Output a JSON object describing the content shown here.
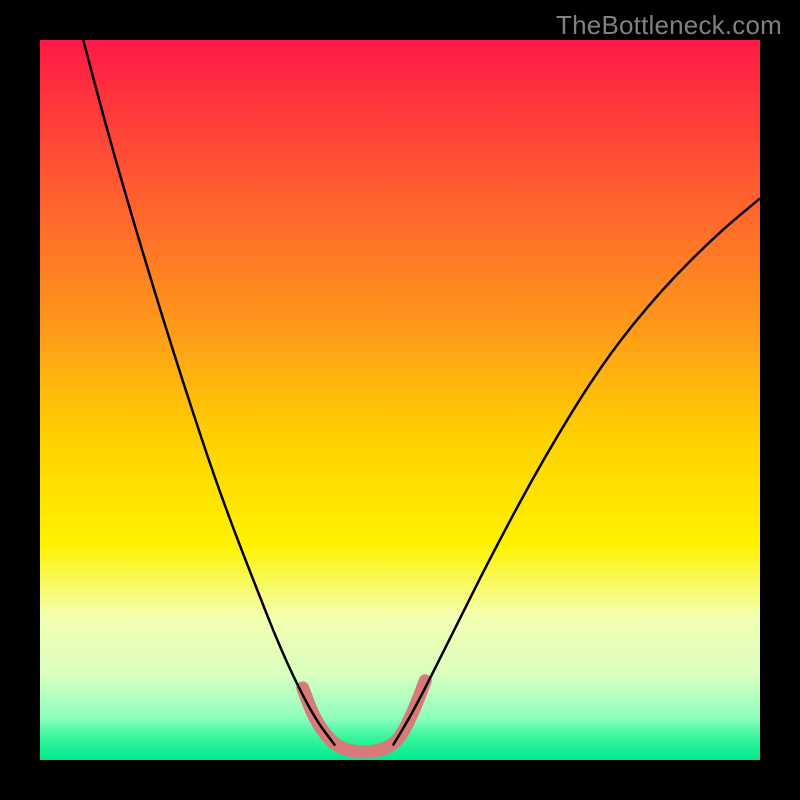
{
  "watermark": "TheBottleneck.com",
  "chart_data": {
    "type": "line",
    "title": "",
    "xlabel": "",
    "ylabel": "",
    "xlim": [
      0,
      100
    ],
    "ylim": [
      0,
      100
    ],
    "gradient_stops": [
      {
        "offset": 0,
        "color": "#ff1a47"
      },
      {
        "offset": 0.1,
        "color": "#ff3a3a"
      },
      {
        "offset": 0.25,
        "color": "#ff6a2a"
      },
      {
        "offset": 0.4,
        "color": "#ff9a1a"
      },
      {
        "offset": 0.55,
        "color": "#ffd000"
      },
      {
        "offset": 0.7,
        "color": "#fff200"
      },
      {
        "offset": 0.8,
        "color": "#f4ffb0"
      },
      {
        "offset": 0.88,
        "color": "#d9ffc0"
      },
      {
        "offset": 0.94,
        "color": "#8fffc0"
      },
      {
        "offset": 0.97,
        "color": "#35f59a"
      },
      {
        "offset": 1.0,
        "color": "#00e890"
      }
    ],
    "series": [
      {
        "name": "left-branch",
        "stroke": "#000000",
        "stroke_width": 2.5,
        "points": [
          {
            "x": 6,
            "y": 100
          },
          {
            "x": 10,
            "y": 85
          },
          {
            "x": 15,
            "y": 68
          },
          {
            "x": 20,
            "y": 52
          },
          {
            "x": 25,
            "y": 37
          },
          {
            "x": 30,
            "y": 24
          },
          {
            "x": 34,
            "y": 14
          },
          {
            "x": 38,
            "y": 6
          },
          {
            "x": 41,
            "y": 2
          }
        ]
      },
      {
        "name": "right-branch",
        "stroke": "#000000",
        "stroke_width": 2.5,
        "points": [
          {
            "x": 49,
            "y": 2
          },
          {
            "x": 52,
            "y": 7
          },
          {
            "x": 57,
            "y": 17
          },
          {
            "x": 63,
            "y": 29
          },
          {
            "x": 70,
            "y": 42
          },
          {
            "x": 78,
            "y": 55
          },
          {
            "x": 86,
            "y": 65
          },
          {
            "x": 94,
            "y": 73
          },
          {
            "x": 100,
            "y": 78
          }
        ]
      },
      {
        "name": "bottom-highlight",
        "stroke": "#d97a7a",
        "stroke_width": 13,
        "linecap": "round",
        "points": [
          {
            "x": 36.5,
            "y": 10
          },
          {
            "x": 38,
            "y": 6
          },
          {
            "x": 40,
            "y": 3
          },
          {
            "x": 42,
            "y": 1.5
          },
          {
            "x": 45,
            "y": 1
          },
          {
            "x": 48,
            "y": 1.5
          },
          {
            "x": 50,
            "y": 3
          },
          {
            "x": 52,
            "y": 7
          },
          {
            "x": 53.5,
            "y": 11
          }
        ]
      }
    ]
  }
}
